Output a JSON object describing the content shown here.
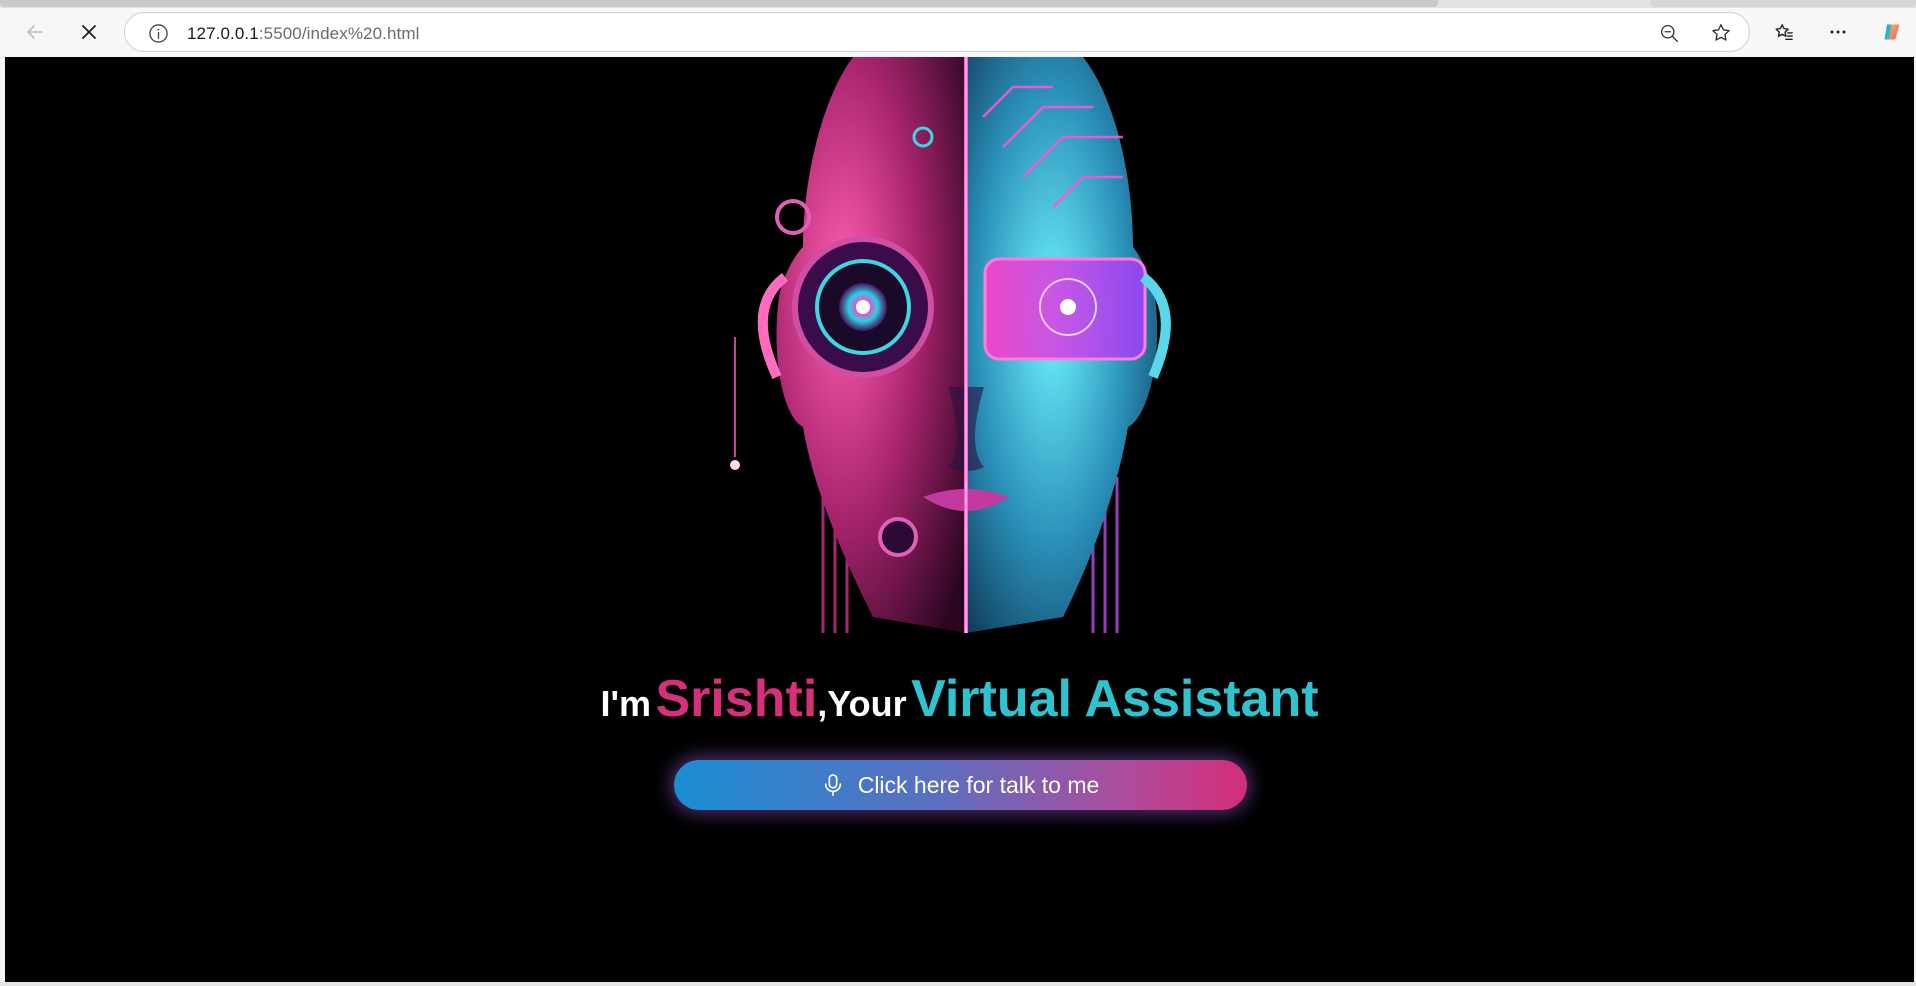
{
  "browser": {
    "url_host": "127.0.0.1",
    "url_path": ":5500/index%20.html",
    "icons": {
      "back": "arrow-left-icon",
      "stop": "close-icon",
      "site_info": "info-icon",
      "zoom": "zoom-out-icon",
      "favorite": "star-icon",
      "favorites_list": "favorites-icon",
      "more": "more-icon",
      "copilot": "copilot-icon"
    }
  },
  "page": {
    "background": "#000000",
    "heading": {
      "prefix": "I'm",
      "name": "Srishti",
      "middle": ",Your",
      "role": "Virtual Assistant",
      "name_color": "#d6307a",
      "role_color": "#2fc3cf"
    },
    "talk_button": {
      "label": "Click here for talk to me",
      "icon": "microphone-icon"
    }
  }
}
